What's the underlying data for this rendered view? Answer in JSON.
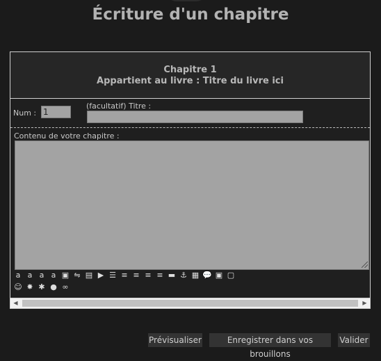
{
  "header": {
    "title": "Écriture d'un chapitre"
  },
  "panel": {
    "chapter_line": "Chapitre 1",
    "book_line": "Appartient au livre : Titre du livre ici"
  },
  "form": {
    "num_label": "Num :",
    "num_value": "1",
    "title_label": "(facultatif) Titre :",
    "title_value": "",
    "content_label": "Contenu de votre chapitre :",
    "content_value": ""
  },
  "toolbar": {
    "row1": [
      {
        "name": "bold-icon",
        "glyph": "a"
      },
      {
        "name": "italic-icon",
        "glyph": "a"
      },
      {
        "name": "underline-icon",
        "glyph": "a"
      },
      {
        "name": "strikethrough-icon",
        "glyph": "a"
      },
      {
        "name": "color-icon",
        "glyph": "▣"
      },
      {
        "name": "highlight-icon",
        "glyph": "⇋"
      },
      {
        "name": "image-icon",
        "glyph": "▤"
      },
      {
        "name": "play-icon",
        "glyph": "▶"
      },
      {
        "name": "list-icon",
        "glyph": "☰"
      },
      {
        "name": "align-left-icon",
        "glyph": "≡"
      },
      {
        "name": "align-center-icon",
        "glyph": "≡"
      },
      {
        "name": "align-right-icon",
        "glyph": "≡"
      },
      {
        "name": "align-justify-icon",
        "glyph": "≡"
      },
      {
        "name": "paragraph-icon",
        "glyph": "▬"
      },
      {
        "name": "anchor-icon",
        "glyph": "⚓"
      },
      {
        "name": "table-icon",
        "glyph": "▦"
      },
      {
        "name": "quote-icon",
        "glyph": "💬"
      },
      {
        "name": "code-icon",
        "glyph": "▣"
      },
      {
        "name": "spoiler-icon",
        "glyph": "▢"
      }
    ],
    "row2": [
      {
        "name": "smileys-icon",
        "glyph": "☺"
      },
      {
        "name": "explosion-icon",
        "glyph": "✸"
      },
      {
        "name": "runner-icon",
        "glyph": "✱"
      },
      {
        "name": "speech-bubble-icon",
        "glyph": "●"
      },
      {
        "name": "link-icon",
        "glyph": "∞"
      }
    ]
  },
  "actions": {
    "preview_label": "Prévisualiser",
    "save_draft_label": "Enregistrer dans vos brouillons",
    "submit_label": "Valider"
  }
}
